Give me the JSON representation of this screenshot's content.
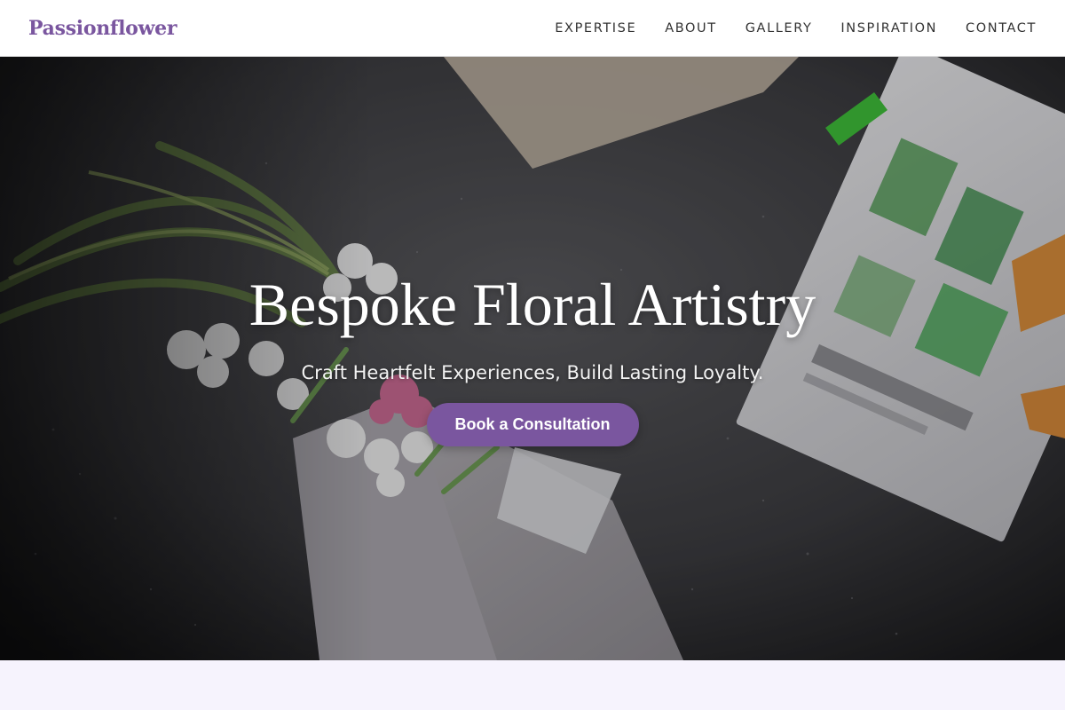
{
  "brand": {
    "name": "Passionflower"
  },
  "nav": {
    "items": [
      {
        "label": "EXPERTISE"
      },
      {
        "label": "ABOUT"
      },
      {
        "label": "GALLERY"
      },
      {
        "label": "INSPIRATION"
      },
      {
        "label": "CONTACT"
      }
    ]
  },
  "hero": {
    "title": "Bespoke Floral Artistry",
    "subtitle": "Craft Heartfelt Experiences, Build Lasting Loyalty.",
    "cta_label": "Book a Consultation"
  },
  "colors": {
    "accent": "#7a569f",
    "nav_text": "#333333",
    "page_bg": "#f6f3fd"
  }
}
